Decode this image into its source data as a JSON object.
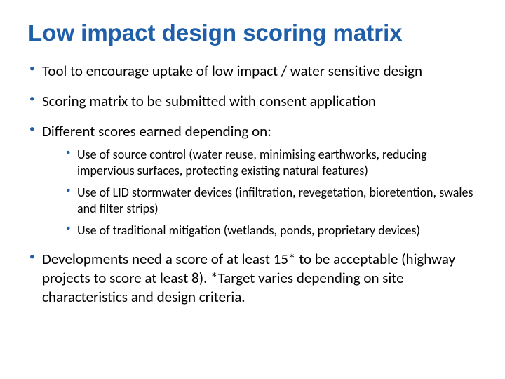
{
  "title": "Low impact design scoring matrix",
  "bullets": {
    "b1": "Tool to encourage uptake of low impact / water sensitive design",
    "b2": "Scoring matrix to be submitted with consent application",
    "b3": "Different scores earned depending on:",
    "b3_sub": {
      "s1": "Use of source control (water reuse, minimising earthworks, reducing impervious surfaces, protecting existing natural features)",
      "s2": "Use of LID stormwater devices (infiltration, revegetation, bioretention, swales and filter strips)",
      "s3": "Use of traditional mitigation (wetlands, ponds, proprietary devices)"
    },
    "b4": "Developments need a score of at least 15* to be acceptable (highway projects to score at least 8). *Target varies depending on site characteristics and design criteria."
  }
}
